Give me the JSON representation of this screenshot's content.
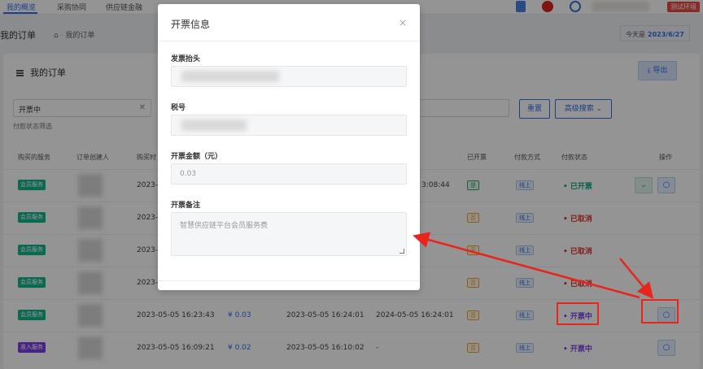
{
  "topnav": {
    "tabs": [
      "我的概览",
      "采购协同",
      "供应链金融"
    ],
    "env_badge": "测试环境"
  },
  "breadcrumb": {
    "page_title": "我的订单",
    "home_sep": "⌂ ·",
    "current": "我的订单",
    "today_label": "今天是",
    "today_value": "2023/6/27"
  },
  "card": {
    "title": "我的订单",
    "export_label": "导出",
    "filter_value": "开票中",
    "filter_hint": "付款状态筛选",
    "reset_label": "重置",
    "advanced_label": "高级搜索"
  },
  "table": {
    "headers": [
      "购买的服务",
      "订单创建人",
      "购买时",
      "已开票",
      "付款方式",
      "付款状态",
      "操作"
    ],
    "rows": [
      {
        "service": "会员服务",
        "service_color": "#14b48c",
        "created": "2023-0",
        "extra_time": "3:08:44",
        "invoiced": "是",
        "pay_method": "线上",
        "status": "已开票",
        "status_color": "green"
      },
      {
        "service": "会员服务",
        "service_color": "#14b48c",
        "created": "2023-0",
        "invoiced": "否",
        "pay_method": "线上",
        "status": "已取消",
        "status_color": "red"
      },
      {
        "service": "会员服务",
        "service_color": "#14b48c",
        "created": "2023-0",
        "invoiced": "否",
        "pay_method": "线上",
        "status": "已取消",
        "status_color": "red"
      },
      {
        "service": "会员服务",
        "service_color": "#14b48c",
        "created": "2023-0",
        "invoiced": "否",
        "pay_method": "线上",
        "status": "已取消",
        "status_color": "red"
      },
      {
        "service": "会员服务",
        "service_color": "#14b48c",
        "created": "2023-05-05 16:23:43",
        "amount": "¥ 0.03",
        "time2": "2023-05-05 16:24:01",
        "time3": "2024-05-05 16:24:01",
        "invoiced": "否",
        "pay_method": "线上",
        "status": "开票中",
        "status_color": "purple"
      },
      {
        "service": "准入服务",
        "service_color": "#7b3fe4",
        "created": "2023-05-05 16:09:21",
        "amount": "¥ 0.02",
        "time2": "2023-05-05 16:10:02",
        "time3": "-",
        "invoiced": "否",
        "pay_method": "线上",
        "status": "开票中",
        "status_color": "purple"
      }
    ]
  },
  "modal": {
    "title": "开票信息",
    "close": "×",
    "invoice_title_label": "发票抬头",
    "tax_no_label": "税号",
    "amount_label": "开票金额（元）",
    "amount_value": "0.03",
    "remark_label": "开票备注",
    "remark_placeholder": "智慧供应链平台会员服务费"
  },
  "colors": {
    "accent": "#2f6fed",
    "annotation_red": "#e8251c"
  }
}
